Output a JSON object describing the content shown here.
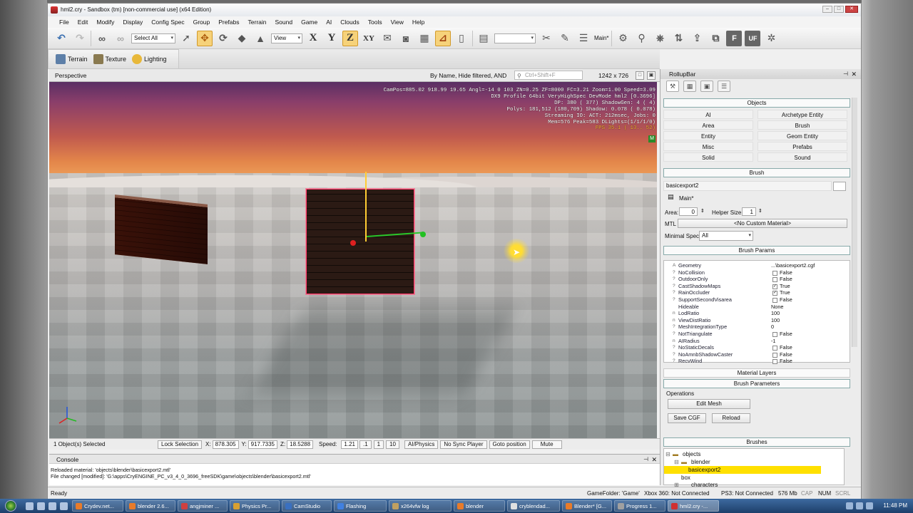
{
  "window": {
    "title": "hml2.cry - Sandbox (tm) [non-commercial use] (x64 Edition)"
  },
  "menu": [
    "File",
    "Edit",
    "Modify",
    "Display",
    "Config Spec",
    "Group",
    "Prefabs",
    "Terrain",
    "Sound",
    "Game",
    "AI",
    "Clouds",
    "Tools",
    "View",
    "Help"
  ],
  "toolbar": {
    "select_combo": "Select All",
    "view_combo": "View",
    "axis_x": "X",
    "axis_y": "Y",
    "axis_z": "Z",
    "axis_xy": "XY",
    "layer_label": "Main*",
    "letter_f": "F",
    "letter_uf": "UF"
  },
  "toolbar2": {
    "terrain": "Terrain",
    "texture": "Texture",
    "lighting": "Lighting"
  },
  "viewport": {
    "title": "Perspective",
    "filter": "By Name, Hide filtered, AND",
    "search_placeholder": "Ctrl+Shift+F",
    "resolution": "1242 x 726",
    "stats": [
      "CamPos=885.02 918.99 19.65 Angl=-14  0 103 ZN=0.25 ZF=8000 FC=3.21 Zoom=1.00 Speed=3.09",
      "DX9 Profile 64bit VeryHighSpec DevMode hml2 [0.3696]",
      "DP:  380 ( 377) ShadowGen:   4 (  4)",
      "Polys: 181,512 (180,709) Shadow: 0.078 ( 0.078)",
      "Streaming IO: ACT: 212msec, Jobs: 0",
      "Mem=576 Peak=583 DLights=(1/1/1/0)"
    ],
    "fps": "FPS  35.1 ( 13.. 52)",
    "badge": "M"
  },
  "status": {
    "selected": "1 Object(s) Selected",
    "lock": "Lock Selection",
    "x_label": "X:",
    "x_val": "878.305",
    "y_label": "Y:",
    "y_val": "917.7335",
    "z_label": "Z:",
    "z_val": "18.5288",
    "speed_label": "Speed:",
    "speed_val": "1.21",
    "s1": ".1",
    "s2": "1",
    "s3": "10",
    "ai": "AI/Physics",
    "sync": "No Sync Player",
    "goto": "Goto position",
    "mute": "Mute"
  },
  "console": {
    "title": "Console",
    "lines": [
      "Reloaded material: 'objects\\blender\\basicexport2.mtl'",
      "File changed [modified]: 'G:\\apps\\CryENGINE_PC_v3_4_0_3696_freeSDK\\game\\objects\\blender\\basicexport2.mtl'"
    ]
  },
  "readybar": {
    "ready": "Ready",
    "folder": "GameFolder: 'Game'",
    "xbox": "Xbox 360: Not Connected",
    "ps3": "PS3: Not Connected",
    "mem": "576 Mb",
    "cap": "CAP",
    "num": "NUM",
    "scrl": "SCRL"
  },
  "rollup": {
    "title": "RollupBar",
    "objects_header": "Objects",
    "object_buttons": [
      "AI",
      "Archetype Entity",
      "Area",
      "Brush",
      "Entity",
      "Geom Entity",
      "Misc",
      "Prefabs",
      "Solid",
      "Sound"
    ],
    "brush_header": "Brush",
    "brush_name": "basicexport2",
    "layer": "Main*",
    "area_label": "Area:",
    "area_val": "0",
    "helper_label": "Helper Size:",
    "helper_val": "1",
    "mtl_label": "MTL",
    "mtl_val": "<No Custom Material>",
    "minspec_label": "Minimal Spec:",
    "minspec_val": "All",
    "params_header": "Brush Params",
    "params": [
      {
        "icon": "A",
        "name": "Geometry",
        "value": "...\\basicexport2.cgf",
        "cb": ""
      },
      {
        "icon": "?",
        "name": "NoCollision",
        "value": "False",
        "cb": " "
      },
      {
        "icon": "?",
        "name": "OutdoorOnly",
        "value": "False",
        "cb": " "
      },
      {
        "icon": "?",
        "name": "CastShadowMaps",
        "value": "True",
        "cb": "✓"
      },
      {
        "icon": "?",
        "name": "RainOccluder",
        "value": "True",
        "cb": "✓"
      },
      {
        "icon": "?",
        "name": "SupportSecondVisarea",
        "value": "False",
        "cb": " "
      },
      {
        "icon": "",
        "name": "Hideable",
        "value": "None",
        "cb": ""
      },
      {
        "icon": "n",
        "name": "LodRatio",
        "value": "100",
        "cb": ""
      },
      {
        "icon": "n",
        "name": "ViewDistRatio",
        "value": "100",
        "cb": ""
      },
      {
        "icon": "?",
        "name": "MeshIntegrationType",
        "value": "0",
        "cb": ""
      },
      {
        "icon": "?",
        "name": "NotTriangulate",
        "value": "False",
        "cb": " "
      },
      {
        "icon": "n",
        "name": "AIRadius",
        "value": "-1",
        "cb": ""
      },
      {
        "icon": "?",
        "name": "NoStaticDecals",
        "value": "False",
        "cb": " "
      },
      {
        "icon": "?",
        "name": "NoAmnbShadowCaster",
        "value": "False",
        "cb": " "
      },
      {
        "icon": "?",
        "name": "RecvWind",
        "value": "False",
        "cb": " "
      }
    ],
    "material_layers": "Material Layers",
    "brush_parameters": "Brush Parameters",
    "operations": "Operations",
    "edit_mesh": "Edit Mesh",
    "save_cgf": "Save CGF",
    "reload": "Reload",
    "brushes_header": "Brushes",
    "tree": [
      "objects",
      "blender",
      "basicexport2",
      "box",
      "characters"
    ]
  },
  "taskbar": {
    "tasks": [
      "Crydev.net...",
      "blender 2.6...",
      "angjminer ...",
      "Physics Pr...",
      "CamStudio",
      "Flashing",
      "x264vfw log",
      "blender",
      "cryblendad...",
      "Blender* [G...",
      "Progress 1...",
      "hml2.cry -..."
    ],
    "clock": "11:48 PM"
  },
  "colors": {
    "selection_yellow": "#ffe000",
    "fps_orange": "#ffb43a",
    "gizmo_green": "#2ac72a",
    "gizmo_yellow": "#ffcc33",
    "selection_pink": "#ff3b6b"
  }
}
